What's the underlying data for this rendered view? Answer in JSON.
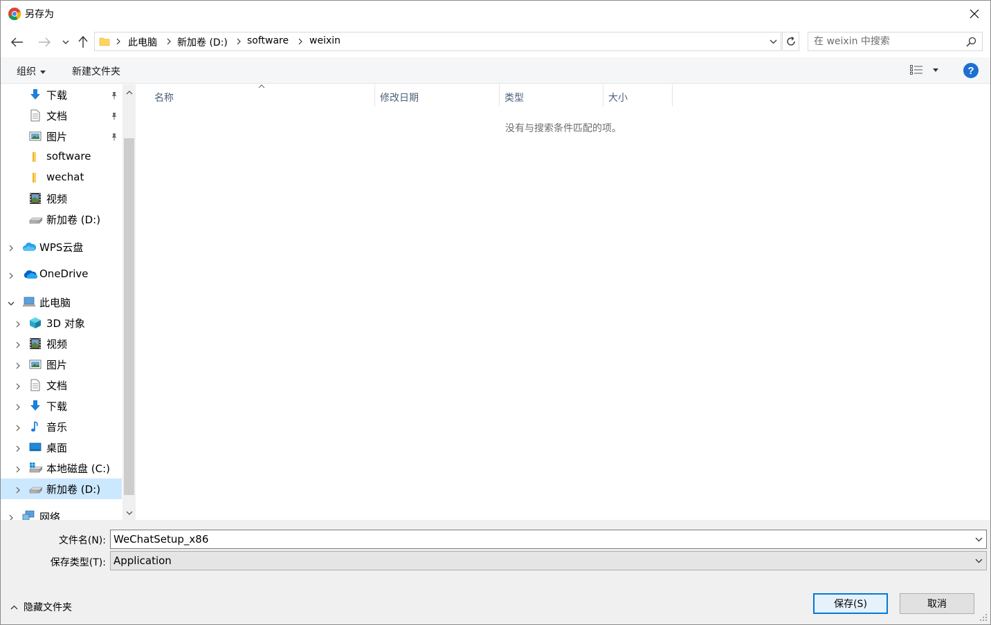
{
  "window": {
    "title": "另存为",
    "colors": {
      "accent": "#0078d7",
      "selection": "#cce8ff",
      "help": "#1e6fd2",
      "folder": "#ffd35c"
    }
  },
  "nav": {
    "breadcrumbs": [
      "此电脑",
      "新加卷 (D:)",
      "software",
      "weixin"
    ],
    "search_placeholder": "在 weixin 中搜索"
  },
  "commandbar": {
    "organize": "组织",
    "new_folder": "新建文件夹",
    "help": "?"
  },
  "tree": [
    {
      "label": "下载",
      "icon": "download-icon",
      "pinned": true
    },
    {
      "label": "文档",
      "icon": "document-icon",
      "pinned": true
    },
    {
      "label": "图片",
      "icon": "pictures-icon",
      "pinned": true
    },
    {
      "label": "software",
      "icon": "folder-icon"
    },
    {
      "label": "wechat",
      "icon": "folder-icon"
    },
    {
      "label": "视频",
      "icon": "video-icon"
    },
    {
      "label": "新加卷 (D:)",
      "icon": "drive-icon"
    },
    {
      "label": "WPS云盘",
      "icon": "cloud-icon",
      "expandable": true
    },
    {
      "label": "OneDrive",
      "icon": "onedrive-icon",
      "expandable": true
    },
    {
      "label": "此电脑",
      "icon": "computer-icon",
      "expanded": true
    },
    {
      "label": "3D 对象",
      "icon": "3d-objects-icon",
      "expandable": true
    },
    {
      "label": "视频",
      "icon": "video-icon",
      "expandable": true
    },
    {
      "label": "图片",
      "icon": "pictures-icon",
      "expandable": true
    },
    {
      "label": "文档",
      "icon": "document-icon",
      "expandable": true
    },
    {
      "label": "下载",
      "icon": "download-icon",
      "expandable": true
    },
    {
      "label": "音乐",
      "icon": "music-icon",
      "expandable": true
    },
    {
      "label": "桌面",
      "icon": "desktop-icon",
      "expandable": true
    },
    {
      "label": "本地磁盘 (C:)",
      "icon": "system-drive-icon",
      "expandable": true
    },
    {
      "label": "新加卷 (D:)",
      "icon": "drive-icon",
      "expandable": true,
      "selected": true
    },
    {
      "label": "网络",
      "icon": "network-icon",
      "expandable": true
    }
  ],
  "filelist": {
    "columns": [
      "名称",
      "修改日期",
      "类型",
      "大小"
    ],
    "empty_message": "没有与搜索条件匹配的项。"
  },
  "form": {
    "filename_label": "文件名(N):",
    "filename_value": "WeChatSetup_x86",
    "filetype_label": "保存类型(T):",
    "filetype_value": "Application"
  },
  "footer": {
    "hide_folders": "隐藏文件夹",
    "save": "保存(S)",
    "cancel": "取消"
  }
}
